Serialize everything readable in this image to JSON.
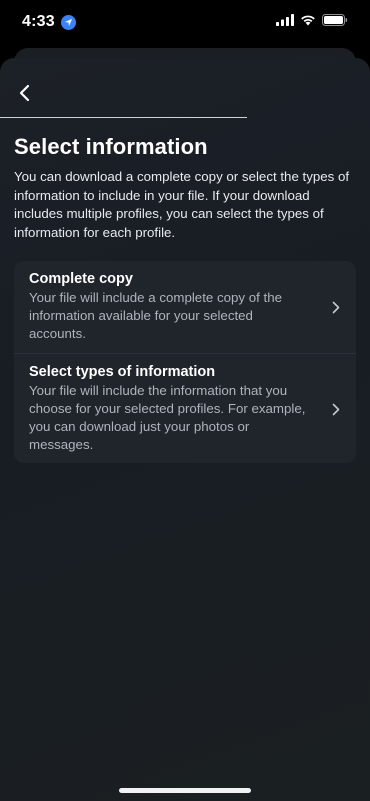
{
  "status_bar": {
    "time": "4:33",
    "icons": [
      "location-arrow-icon",
      "signal-icon",
      "wifi-icon",
      "battery-icon"
    ],
    "location_color": "#3b82f6"
  },
  "header": {
    "back_icon": "chevron-left-icon"
  },
  "page": {
    "title": "Select information",
    "description": "You can download a complete copy or select the types of information to include in your file. If your download includes multiple profiles, you can select the types of information for each profile."
  },
  "options": [
    {
      "title": "Complete copy",
      "description": "Your file will include a complete copy of the information available for your selected accounts.",
      "icon": "chevron-right-icon"
    },
    {
      "title": "Select types of information",
      "description": "Your file will include the information that you choose for your selected profiles. For example, you can download just your photos or messages.",
      "icon": "chevron-right-icon"
    }
  ]
}
